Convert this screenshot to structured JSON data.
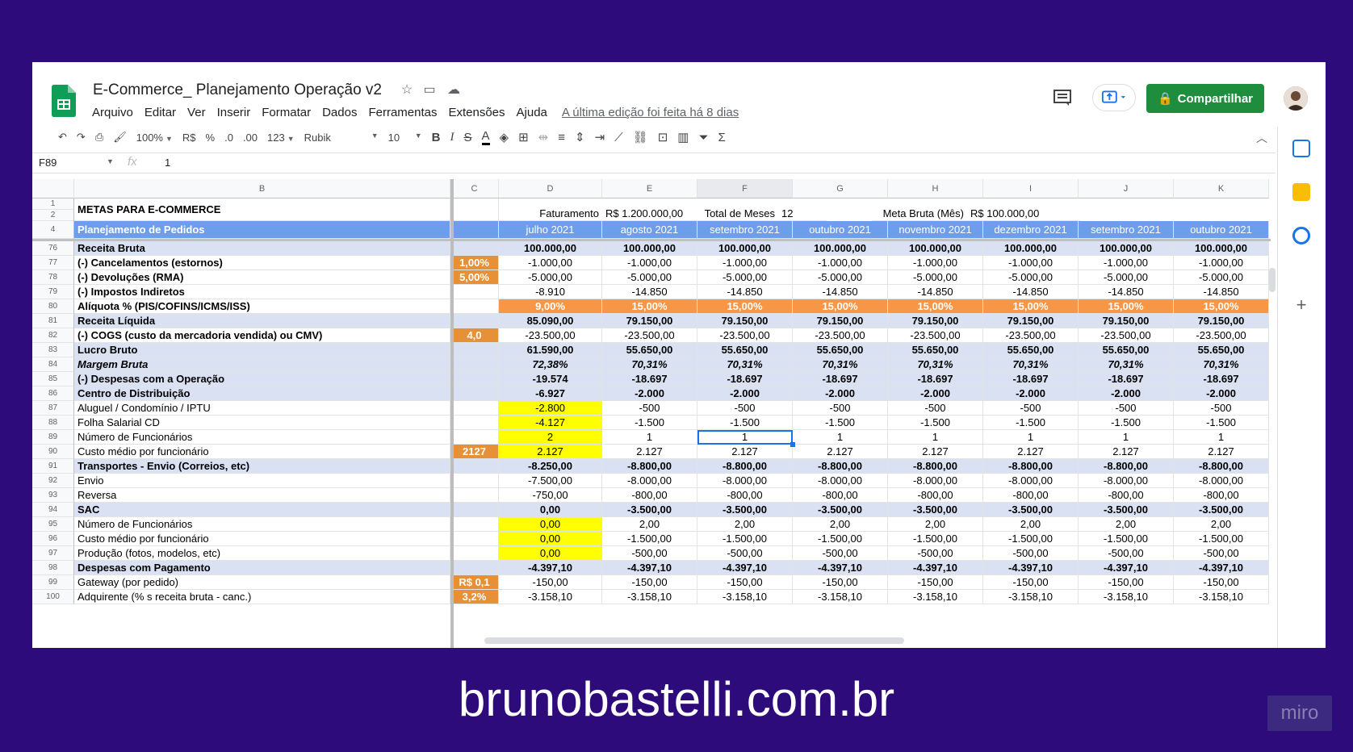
{
  "doc": {
    "title": "E-Commerce_ Planejamento Operação v2",
    "menu": [
      "Arquivo",
      "Editar",
      "Ver",
      "Inserir",
      "Formatar",
      "Dados",
      "Ferramentas",
      "Extensões",
      "Ajuda"
    ],
    "last_edit": "A última edição foi feita há 8 dias",
    "share_label": "Compartilhar"
  },
  "toolbar": {
    "zoom": "100%",
    "currency": "R$",
    "percent": "%",
    "dec_less": ".0",
    "dec_more": ".00",
    "format": "123",
    "font": "Rubik",
    "size": "10"
  },
  "formula_bar": {
    "cell_ref": "F89",
    "fx": "fx",
    "value": "1"
  },
  "columns": [
    "B",
    "C",
    "D",
    "E",
    "F",
    "G",
    "H",
    "I",
    "J",
    "K"
  ],
  "header_rows": {
    "row_numbers": [
      "1",
      "2",
      "4"
    ],
    "title": "METAS PARA E-COMMERCE",
    "faturamento_label": "Faturamento",
    "faturamento_value": "R$ 1.200.000,00",
    "total_meses_label": "Total de Meses",
    "total_meses_value": "12",
    "meta_label": "Meta Bruta (Mês)",
    "meta_value": "R$ 100.000,00",
    "plan_label": "Planejamento de Pedidos",
    "months": [
      "julho 2021",
      "agosto 2021",
      "setembro 2021",
      "outubro 2021",
      "novembro 2021",
      "dezembro 2021",
      "setembro 2021",
      "outubro 2021"
    ]
  },
  "rows": [
    {
      "n": "76",
      "label": "Receita Bruta",
      "style": "blue b",
      "c": "",
      "cstyle": "",
      "vals": [
        "100.000,00",
        "100.000,00",
        "100.000,00",
        "100.000,00",
        "100.000,00",
        "100.000,00",
        "100.000,00",
        "100.000,00"
      ]
    },
    {
      "n": "77",
      "label": "(-) Cancelamentos (estornos)",
      "style": "b",
      "c": "1,00%",
      "cstyle": "orange2",
      "vals": [
        "-1.000,00",
        "-1.000,00",
        "-1.000,00",
        "-1.000,00",
        "-1.000,00",
        "-1.000,00",
        "-1.000,00",
        "-1.000,00"
      ]
    },
    {
      "n": "78",
      "label": "(-) Devoluções (RMA)",
      "style": "b",
      "c": "5,00%",
      "cstyle": "orange2",
      "vals": [
        "-5.000,00",
        "-5.000,00",
        "-5.000,00",
        "-5.000,00",
        "-5.000,00",
        "-5.000,00",
        "-5.000,00",
        "-5.000,00"
      ]
    },
    {
      "n": "79",
      "label": "(-) Impostos Indiretos",
      "style": "b",
      "c": "",
      "cstyle": "",
      "vals": [
        "-8.910",
        "-14.850",
        "-14.850",
        "-14.850",
        "-14.850",
        "-14.850",
        "-14.850",
        "-14.850"
      ]
    },
    {
      "n": "80",
      "label": "Alíquota % (PIS/COFINS/ICMS/ISS)",
      "style": "b",
      "c": "",
      "cstyle": "",
      "vstyle": "orangebar",
      "vals": [
        "9,00%",
        "15,00%",
        "15,00%",
        "15,00%",
        "15,00%",
        "15,00%",
        "15,00%",
        "15,00%"
      ]
    },
    {
      "n": "81",
      "label": "Receita Líquida",
      "style": "blue b",
      "c": "",
      "cstyle": "",
      "vals": [
        "85.090,00",
        "79.150,00",
        "79.150,00",
        "79.150,00",
        "79.150,00",
        "79.150,00",
        "79.150,00",
        "79.150,00"
      ]
    },
    {
      "n": "82",
      "label": "(-) COGS (custo da mercadoria vendida) ou CMV)",
      "style": "b",
      "c": "4,0",
      "cstyle": "orange2",
      "vals": [
        "-23.500,00",
        "-23.500,00",
        "-23.500,00",
        "-23.500,00",
        "-23.500,00",
        "-23.500,00",
        "-23.500,00",
        "-23.500,00"
      ]
    },
    {
      "n": "83",
      "label": "Lucro Bruto",
      "style": "blue b",
      "c": "",
      "cstyle": "",
      "vals": [
        "61.590,00",
        "55.650,00",
        "55.650,00",
        "55.650,00",
        "55.650,00",
        "55.650,00",
        "55.650,00",
        "55.650,00"
      ]
    },
    {
      "n": "84",
      "label": "Margem Bruta",
      "style": "blue b i",
      "c": "",
      "cstyle": "",
      "vals": [
        "72,38%",
        "70,31%",
        "70,31%",
        "70,31%",
        "70,31%",
        "70,31%",
        "70,31%",
        "70,31%"
      ]
    },
    {
      "n": "85",
      "label": "(-) Despesas com a Operação",
      "style": "blue b",
      "c": "",
      "cstyle": "",
      "vals": [
        "-19.574",
        "-18.697",
        "-18.697",
        "-18.697",
        "-18.697",
        "-18.697",
        "-18.697",
        "-18.697"
      ]
    },
    {
      "n": "86",
      "label": "Centro de Distribuição",
      "style": "blue b",
      "c": "",
      "cstyle": "",
      "vals": [
        "-6.927",
        "-2.000",
        "-2.000",
        "-2.000",
        "-2.000",
        "-2.000",
        "-2.000",
        "-2.000"
      ]
    },
    {
      "n": "87",
      "label": "Aluguel / Condomínio / IPTU",
      "style": "",
      "c": "",
      "cstyle": "",
      "dstyle": "yellow",
      "vals": [
        "-2.800",
        "-500",
        "-500",
        "-500",
        "-500",
        "-500",
        "-500",
        "-500"
      ]
    },
    {
      "n": "88",
      "label": "Folha Salarial CD",
      "style": "",
      "c": "",
      "cstyle": "",
      "dstyle": "yellow",
      "vals": [
        "-4.127",
        "-1.500",
        "-1.500",
        "-1.500",
        "-1.500",
        "-1.500",
        "-1.500",
        "-1.500"
      ]
    },
    {
      "n": "89",
      "label": "Número de Funcionários",
      "style": "",
      "c": "",
      "cstyle": "",
      "dstyle": "yellow",
      "vals": [
        "2",
        "1",
        "1",
        "1",
        "1",
        "1",
        "1",
        "1"
      ]
    },
    {
      "n": "90",
      "label": "Custo médio por funcionário",
      "style": "",
      "c": "2127",
      "cstyle": "orange2",
      "dstyle": "yellow",
      "vals": [
        "2.127",
        "2.127",
        "2.127",
        "2.127",
        "2.127",
        "2.127",
        "2.127",
        "2.127"
      ]
    },
    {
      "n": "91",
      "label": "Transportes - Envio (Correios, etc)",
      "style": "blue b",
      "c": "",
      "cstyle": "",
      "vals": [
        "-8.250,00",
        "-8.800,00",
        "-8.800,00",
        "-8.800,00",
        "-8.800,00",
        "-8.800,00",
        "-8.800,00",
        "-8.800,00"
      ]
    },
    {
      "n": "92",
      "label": "Envio",
      "style": "",
      "c": "",
      "cstyle": "",
      "vals": [
        "-7.500,00",
        "-8.000,00",
        "-8.000,00",
        "-8.000,00",
        "-8.000,00",
        "-8.000,00",
        "-8.000,00",
        "-8.000,00"
      ]
    },
    {
      "n": "93",
      "label": "Reversa",
      "style": "",
      "c": "",
      "cstyle": "",
      "vals": [
        "-750,00",
        "-800,00",
        "-800,00",
        "-800,00",
        "-800,00",
        "-800,00",
        "-800,00",
        "-800,00"
      ]
    },
    {
      "n": "94",
      "label": "SAC",
      "style": "blue b",
      "c": "",
      "cstyle": "",
      "vals": [
        "0,00",
        "-3.500,00",
        "-3.500,00",
        "-3.500,00",
        "-3.500,00",
        "-3.500,00",
        "-3.500,00",
        "-3.500,00"
      ]
    },
    {
      "n": "95",
      "label": "Número de Funcionários",
      "style": "",
      "c": "",
      "cstyle": "",
      "dstyle": "yellow",
      "vals": [
        "0,00",
        "2,00",
        "2,00",
        "2,00",
        "2,00",
        "2,00",
        "2,00",
        "2,00"
      ]
    },
    {
      "n": "96",
      "label": "Custo médio por funcionário",
      "style": "",
      "c": "",
      "cstyle": "",
      "dstyle": "yellow",
      "vals": [
        "0,00",
        "-1.500,00",
        "-1.500,00",
        "-1.500,00",
        "-1.500,00",
        "-1.500,00",
        "-1.500,00",
        "-1.500,00"
      ]
    },
    {
      "n": "97",
      "label": "Produção (fotos, modelos, etc)",
      "style": "",
      "c": "",
      "cstyle": "",
      "dstyle": "yellow",
      "vals": [
        "0,00",
        "-500,00",
        "-500,00",
        "-500,00",
        "-500,00",
        "-500,00",
        "-500,00",
        "-500,00"
      ]
    },
    {
      "n": "98",
      "label": "Despesas com Pagamento",
      "style": "blue b",
      "c": "",
      "cstyle": "",
      "vals": [
        "-4.397,10",
        "-4.397,10",
        "-4.397,10",
        "-4.397,10",
        "-4.397,10",
        "-4.397,10",
        "-4.397,10",
        "-4.397,10"
      ]
    },
    {
      "n": "99",
      "label": "Gateway (por pedido)",
      "style": "",
      "c": "R$ 0,1",
      "cstyle": "orange2",
      "vals": [
        "-150,00",
        "-150,00",
        "-150,00",
        "-150,00",
        "-150,00",
        "-150,00",
        "-150,00",
        "-150,00"
      ]
    },
    {
      "n": "100",
      "label": "Adquirente (% s receita bruta - canc.)",
      "style": "",
      "c": "3,2%",
      "cstyle": "orange2",
      "vals": [
        "-3.158,10",
        "-3.158,10",
        "-3.158,10",
        "-3.158,10",
        "-3.158,10",
        "-3.158,10",
        "-3.158,10",
        "-3.158,10"
      ]
    }
  ],
  "selected": {
    "row": "89",
    "col": "F"
  },
  "colors": {
    "accent_green": "#1e8e3e",
    "header_blue": "#6d9eeb",
    "row_blue": "#d9e1f2",
    "input_yellow": "#ffff00",
    "param_orange": "#e69138",
    "background": "#2e0b7a"
  },
  "footer_text": "brunobastelli.com.br",
  "watermark": "miro"
}
